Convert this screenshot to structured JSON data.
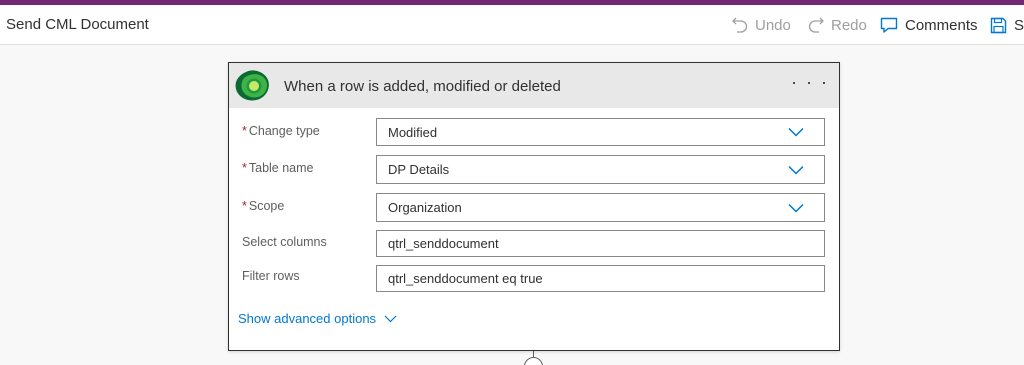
{
  "header": {
    "flow_title": "Send CML Document",
    "accent_color": "#742774",
    "toolbar": {
      "undo_label": "Undo",
      "redo_label": "Redo",
      "comments_label": "Comments",
      "save_label": "Sa"
    }
  },
  "trigger_card": {
    "title": "When a row is added, modified or deleted",
    "menu_label": "· · ·",
    "icon": "dataverse-icon",
    "fields": {
      "change_type": {
        "label": "Change type",
        "value": "Modified",
        "required": "*"
      },
      "table_name": {
        "label": "Table name",
        "value": "DP Details",
        "required": "*"
      },
      "scope": {
        "label": "Scope",
        "value": "Organization",
        "required": "*"
      },
      "select_columns": {
        "label": "Select columns",
        "value": "qtrl_senddocument"
      },
      "filter_rows": {
        "label": "Filter rows",
        "value": "qtrl_senddocument eq true"
      }
    },
    "advanced_options_label": "Show advanced options"
  },
  "colors": {
    "link_blue": "#0078d4",
    "required_red": "#a4262c",
    "card_header_bg": "#e8e8e8"
  }
}
